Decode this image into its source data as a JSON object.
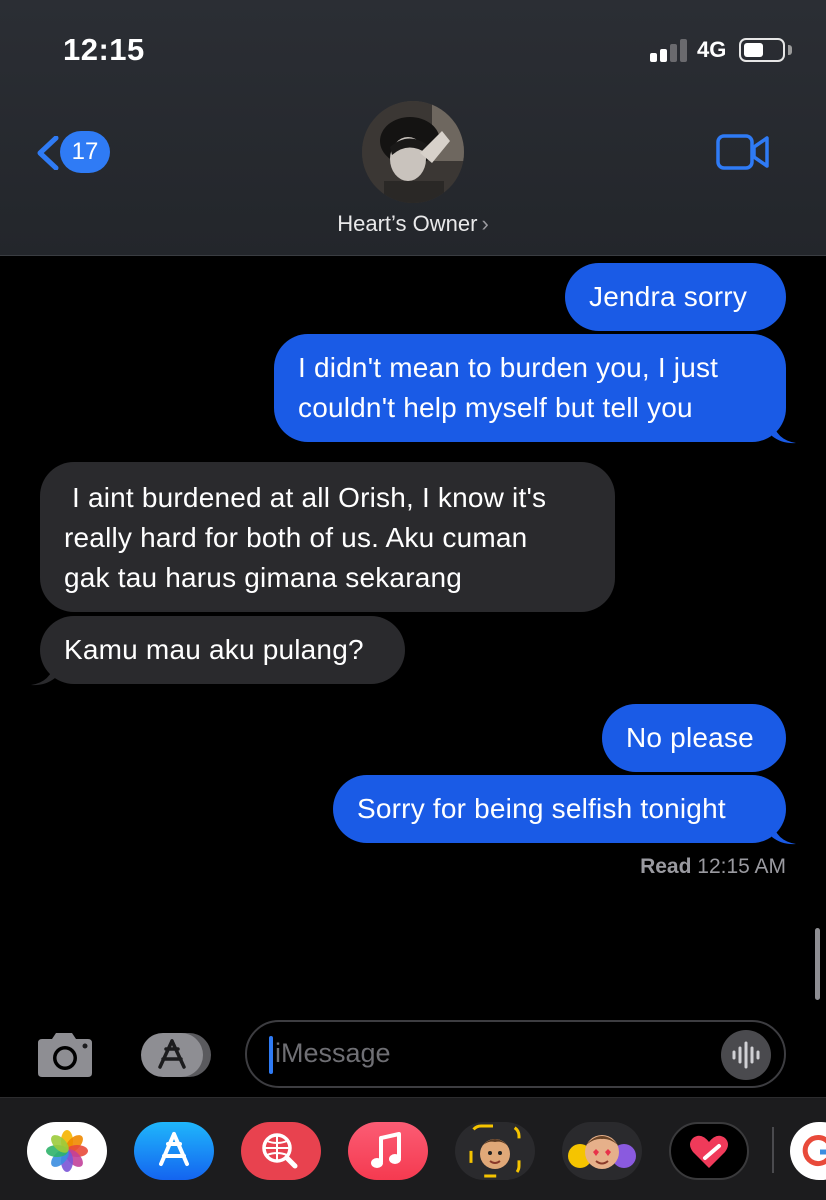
{
  "status_bar": {
    "time": "12:15",
    "network": "4G"
  },
  "header": {
    "back_count": "17",
    "contact_name": "Heart’s Owner"
  },
  "messages": [
    {
      "from": "me",
      "lines": [
        "Jendra sorry"
      ]
    },
    {
      "from": "me",
      "lines": [
        "I didn't mean to burden you, I just",
        "couldn't help myself but tell you"
      ]
    },
    {
      "from": "them",
      "lines": [
        " I aint burdened at all Orish, I know it's",
        "really hard for both of us. Aku cuman",
        "gak tau harus gimana sekarang"
      ]
    },
    {
      "from": "them",
      "lines": [
        "Kamu mau aku pulang?"
      ]
    },
    {
      "from": "me",
      "lines": [
        "No please"
      ]
    },
    {
      "from": "me",
      "lines": [
        "Sorry for being selfish tonight"
      ]
    }
  ],
  "receipt": {
    "label": "Read",
    "time": "12:15 AM"
  },
  "composer": {
    "placeholder": "iMessage"
  },
  "app_drawer": [
    "photos-app-icon",
    "app-store-icon",
    "search-images-icon",
    "music-icon",
    "memoji-icon",
    "memoji-stickers-icon",
    "digital-touch-icon",
    "more-apps-icon"
  ],
  "colors": {
    "sent_bubble": "#1a5be6",
    "received_bubble": "#2a2a2d",
    "accent": "#2f7bf5"
  }
}
